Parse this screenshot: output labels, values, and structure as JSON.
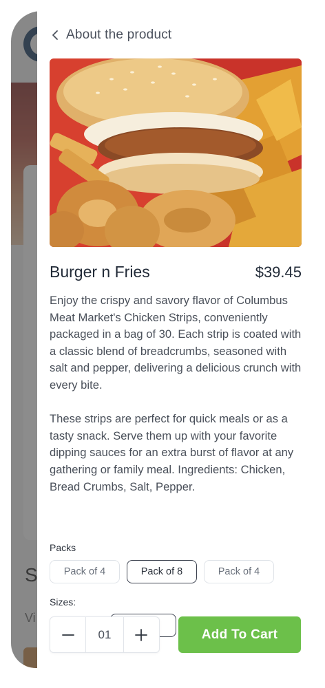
{
  "header": {
    "back_icon": "chevron-left-icon",
    "title": "About the product"
  },
  "product": {
    "name": "Burger n Fries",
    "price": "$39.45",
    "description": [
      "Enjoy the crispy and savory flavor of Columbus Meat Market's Chicken Strips, conveniently packaged in a bag of 30. Each strip is coated with a classic blend of breadcrumbs, seasoned with salt and pepper, delivering a delicious crunch with every bite.",
      "These strips are perfect for quick meals or as a tasty snack. Serve them up with your favorite dipping sauces for an extra burst of flavor at any gathering or family meal. Ingredients: Chicken, Bread Crumbs, Salt, Pepper."
    ]
  },
  "options": {
    "packs_label": "Packs",
    "packs": [
      {
        "label": "Pack of 4",
        "selected": false
      },
      {
        "label": "Pack of 8",
        "selected": true
      },
      {
        "label": "Pack of 4",
        "selected": false
      }
    ],
    "sizes_label": "Sizes:"
  },
  "cart": {
    "quantity": "01",
    "decrement_icon": "minus-icon",
    "increment_icon": "plus-icon",
    "add_label": "Add To Cart"
  },
  "background": {
    "peek_heading": "S",
    "peek_text": "Vi"
  },
  "colors": {
    "accent_green": "#6cc04a",
    "text_dark": "#222b38",
    "overlay": "#464646"
  }
}
